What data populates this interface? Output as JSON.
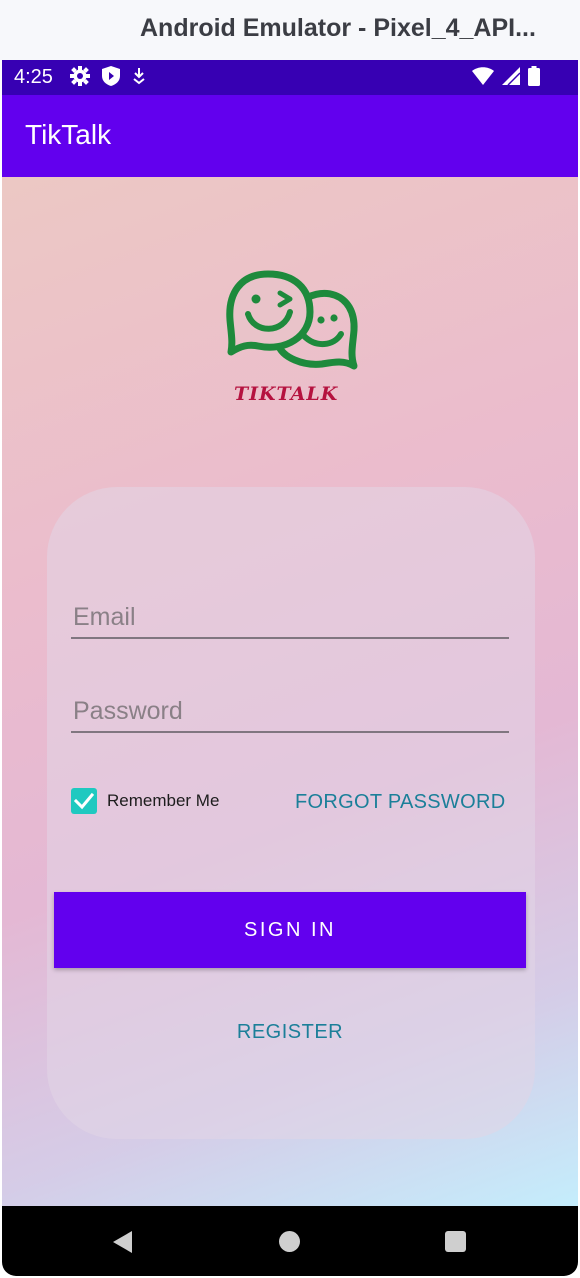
{
  "window": {
    "title": "Android Emulator - Pixel_4_API..."
  },
  "status_bar": {
    "time": "4:25",
    "icons": [
      "gear-icon",
      "shield-icon",
      "download-icon",
      "wifi-icon",
      "signal-icon",
      "battery-icon"
    ]
  },
  "app_bar": {
    "title": "TikTalk"
  },
  "logo": {
    "text": "TIKTALK",
    "icon": "chat-smiley-logo",
    "color": "#1e8a3c",
    "text_color": "#b5123f"
  },
  "form": {
    "email_placeholder": "Email",
    "password_placeholder": "Password",
    "remember_label": "Remember Me",
    "remember_checked": true,
    "forgot_label": "FORGOT PASSWORD",
    "signin_label": "SIGN IN",
    "register_label": "REGISTER"
  },
  "colors": {
    "primary": "#6200ee",
    "status_bar": "#3700b3",
    "accent_link": "#1b7f99",
    "checkbox": "#1fc9c0"
  },
  "nav_bar": {
    "icons": [
      "back-icon",
      "home-icon",
      "recents-icon"
    ]
  }
}
